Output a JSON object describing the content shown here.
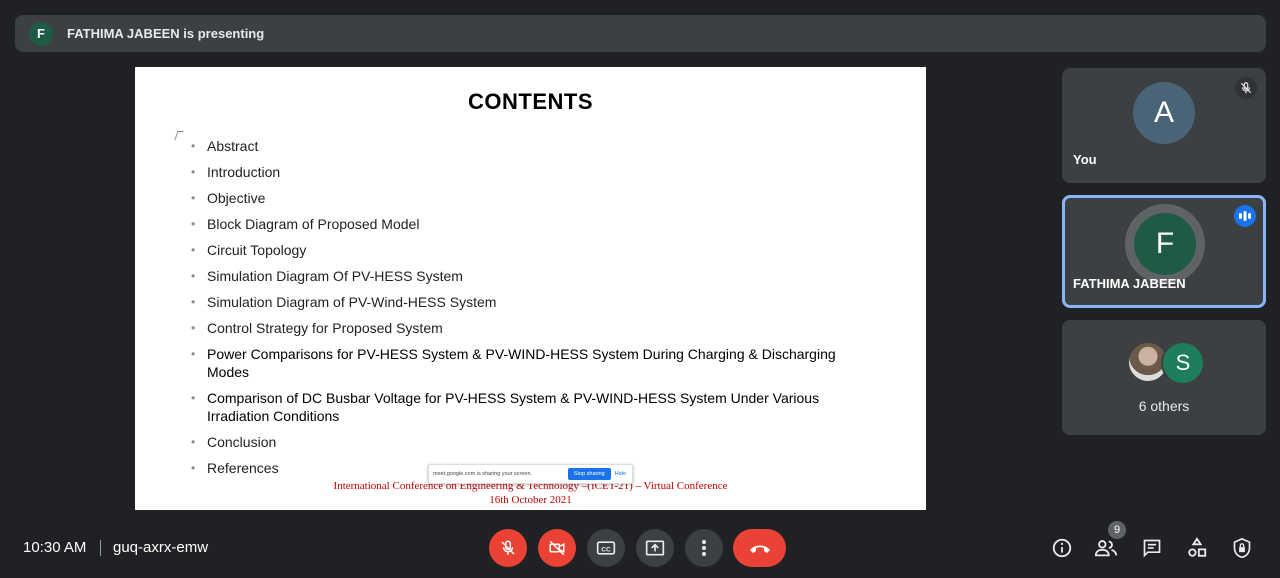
{
  "banner": {
    "avatar_letter": "F",
    "text": "FATHIMA JABEEN is presenting"
  },
  "slide": {
    "title": "CONTENTS",
    "items": [
      "Abstract",
      "Introduction",
      "Objective",
      "Block Diagram of Proposed Model",
      "Circuit Topology",
      "Simulation Diagram Of PV-HESS System",
      "Simulation Diagram of PV-Wind-HESS System",
      "Control Strategy for Proposed System",
      "Power Comparisons for PV-HESS System & PV-WIND-HESS System During Charging & Discharging Modes",
      "Comparison of DC Busbar Voltage for PV-HESS System & PV-WIND-HESS System Under Various Irradiation Conditions",
      "Conclusion",
      "References"
    ],
    "footer_line1": "International Conference on Engineering & Technology –(ICET-21) – Virtual Conference",
    "footer_date": "16th October 2021"
  },
  "share_popup": {
    "text": "meet.google.com is sharing your screen.",
    "stop_label": "Stop sharing",
    "hide_label": "Hide"
  },
  "tiles": {
    "you": {
      "letter": "A",
      "name": "You"
    },
    "presenter": {
      "letter": "F",
      "name": "FATHIMA JABEEN"
    },
    "others": {
      "letter": "S",
      "label": "6 others"
    }
  },
  "bottom": {
    "time": "10:30 AM",
    "meeting_code": "guq-axrx-emw",
    "participants_count": "9"
  },
  "colors": {
    "background": "#202124",
    "surface": "#3c4043",
    "danger": "#ea4335",
    "accent": "#8ab4f8",
    "presenter_avatar": "#1e5a44"
  }
}
